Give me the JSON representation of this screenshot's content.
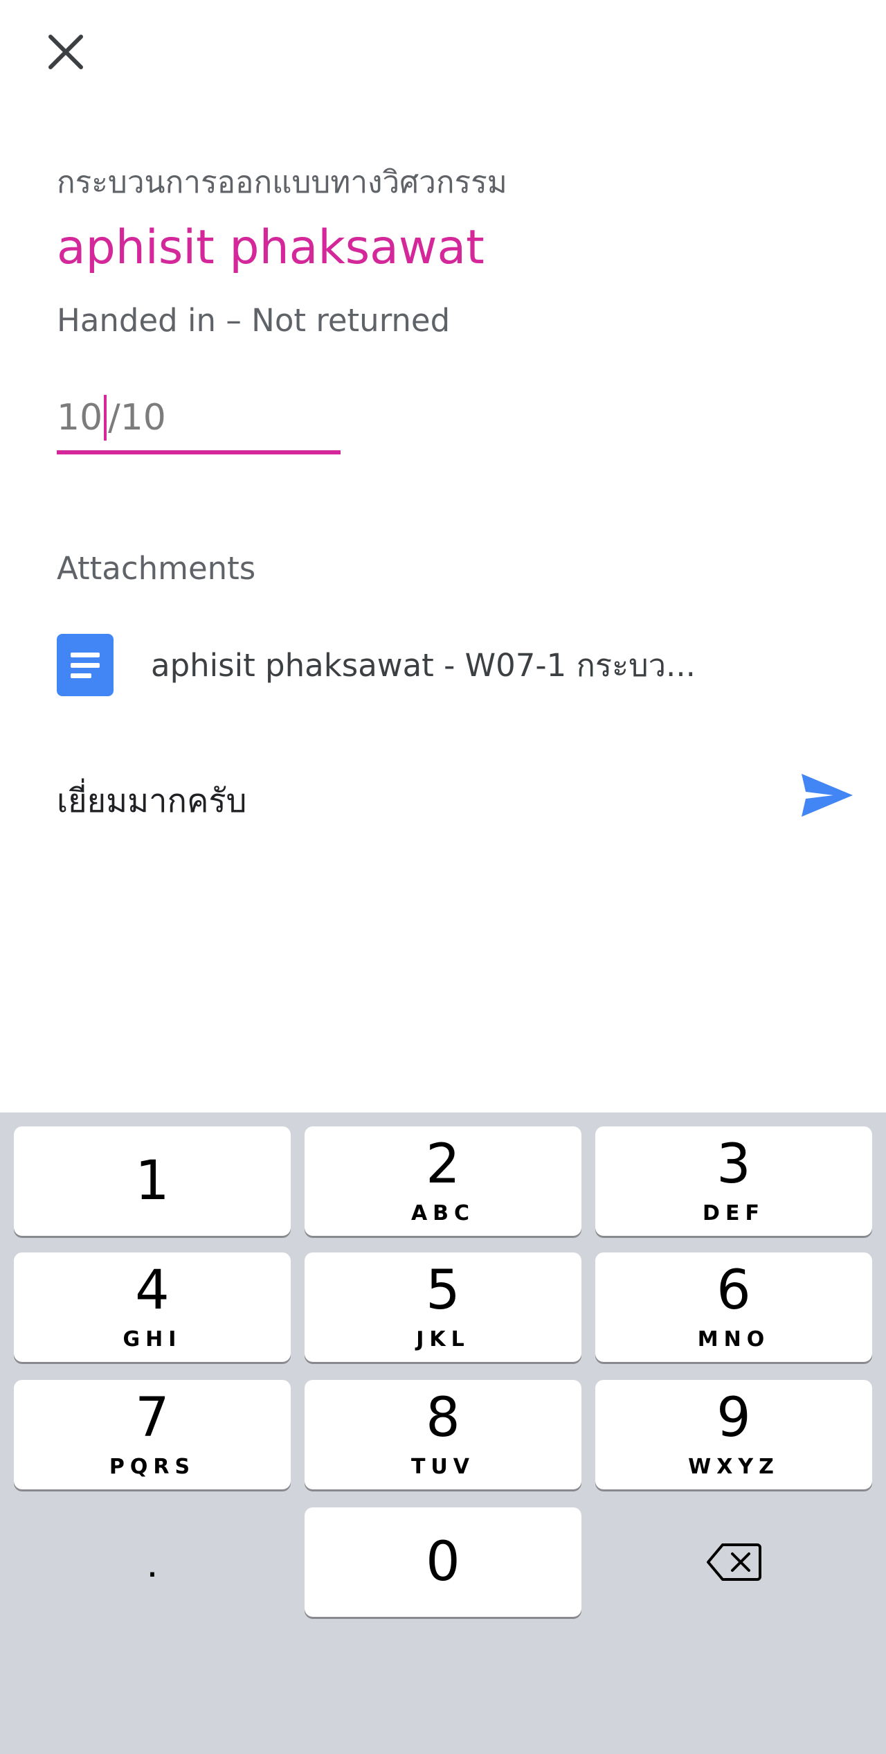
{
  "header": {
    "close_icon": "close-icon",
    "course_name": "กระบวนการออกแบบทางวิศวกรรม",
    "student_name": "aphisit phaksawat",
    "status": "Handed in – Not returned"
  },
  "grade": {
    "value": "10",
    "max": "/10"
  },
  "attachments": {
    "heading": "Attachments",
    "items": [
      {
        "icon": "google-docs-icon",
        "name": "aphisit phaksawat - W07-1 กระบว..."
      }
    ]
  },
  "comment": {
    "text": "เยี่ยมมากครับ",
    "send_icon": "send-icon"
  },
  "keypad": {
    "keys": [
      {
        "digit": "1",
        "letters": ""
      },
      {
        "digit": "2",
        "letters": "ABC"
      },
      {
        "digit": "3",
        "letters": "DEF"
      },
      {
        "digit": "4",
        "letters": "GHI"
      },
      {
        "digit": "5",
        "letters": "JKL"
      },
      {
        "digit": "6",
        "letters": "MNO"
      },
      {
        "digit": "7",
        "letters": "PQRS"
      },
      {
        "digit": "8",
        "letters": "TUV"
      },
      {
        "digit": "9",
        "letters": "WXYZ"
      },
      {
        "digit": ".",
        "letters": ""
      },
      {
        "digit": "0",
        "letters": ""
      }
    ],
    "delete_icon": "backspace-icon"
  },
  "colors": {
    "accent": "#d4279a",
    "primary_blue": "#4285f4",
    "keypad_bg": "#d1d4da"
  }
}
